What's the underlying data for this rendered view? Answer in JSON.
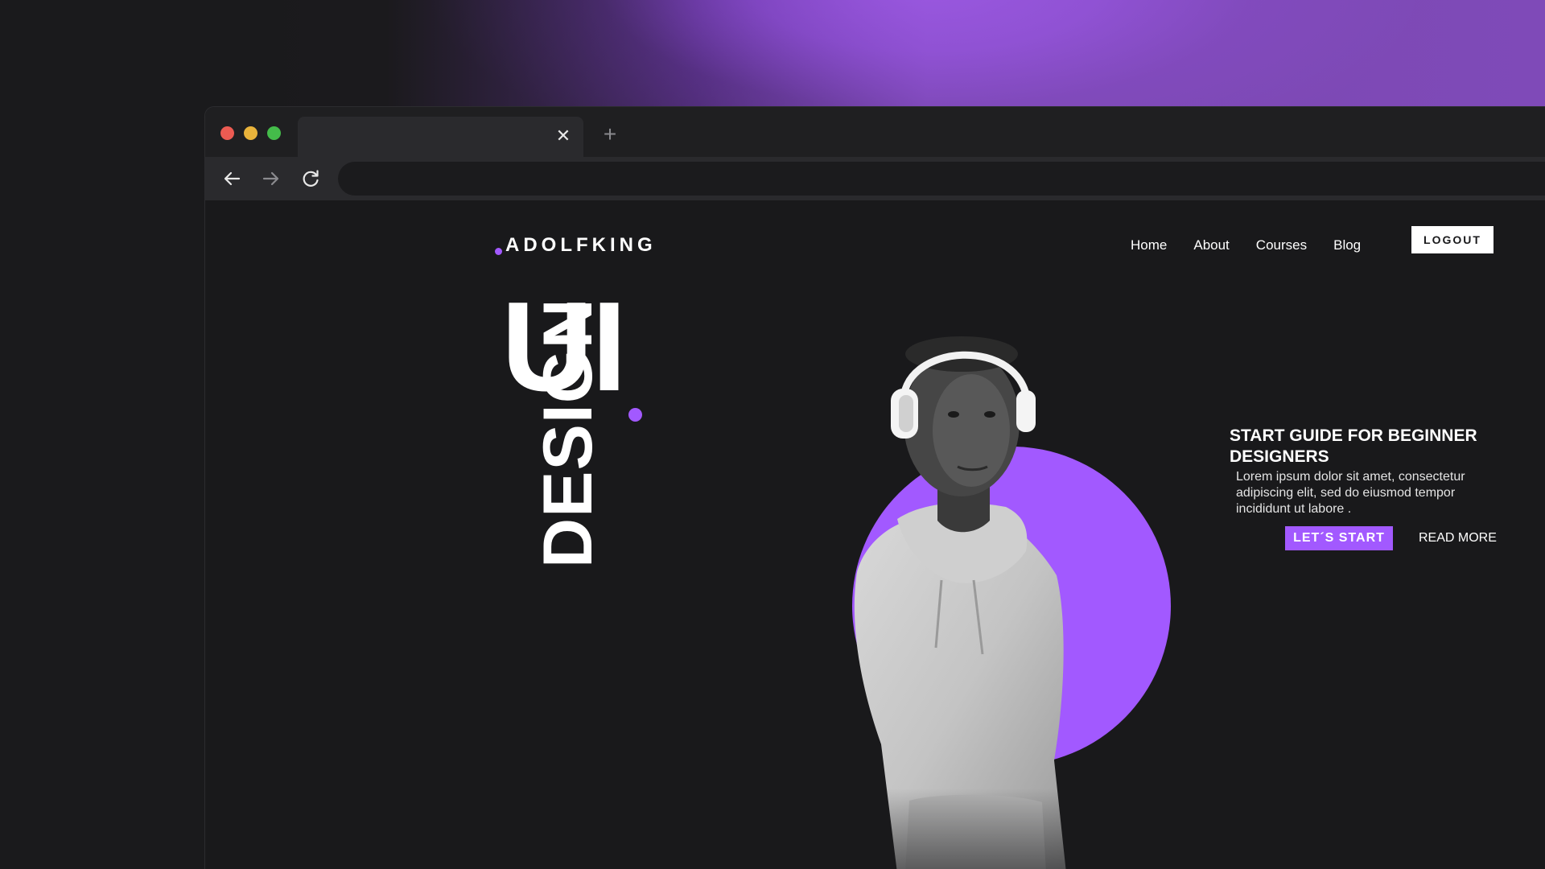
{
  "browser": {
    "tab_close_glyph": "✕",
    "new_tab_glyph": "+",
    "icons": {
      "back": "arrow-left-icon",
      "forward": "arrow-right-icon",
      "reload": "reload-icon"
    },
    "traffic_lights": [
      "#ec5b52",
      "#e9b33b",
      "#44bc4a"
    ]
  },
  "site": {
    "logo": "ADOLFKING",
    "nav": [
      "Home",
      "About",
      "Courses",
      "Blog"
    ],
    "logout_label": "LOGOUT",
    "hero": {
      "headline_big": "UI",
      "headline_vertical": "DESIGN",
      "title": "START GUIDE FOR BEGINNER DESIGNERS",
      "body": "Lorem ipsum dolor sit amet, consectetur adipiscing elit, sed do eiusmod tempor incididunt ut labore .",
      "primary_cta": "LET´S START",
      "secondary_cta": "READ MORE"
    }
  },
  "colors": {
    "accent": "#a259ff",
    "background": "#19191b",
    "text": "#ffffff"
  }
}
